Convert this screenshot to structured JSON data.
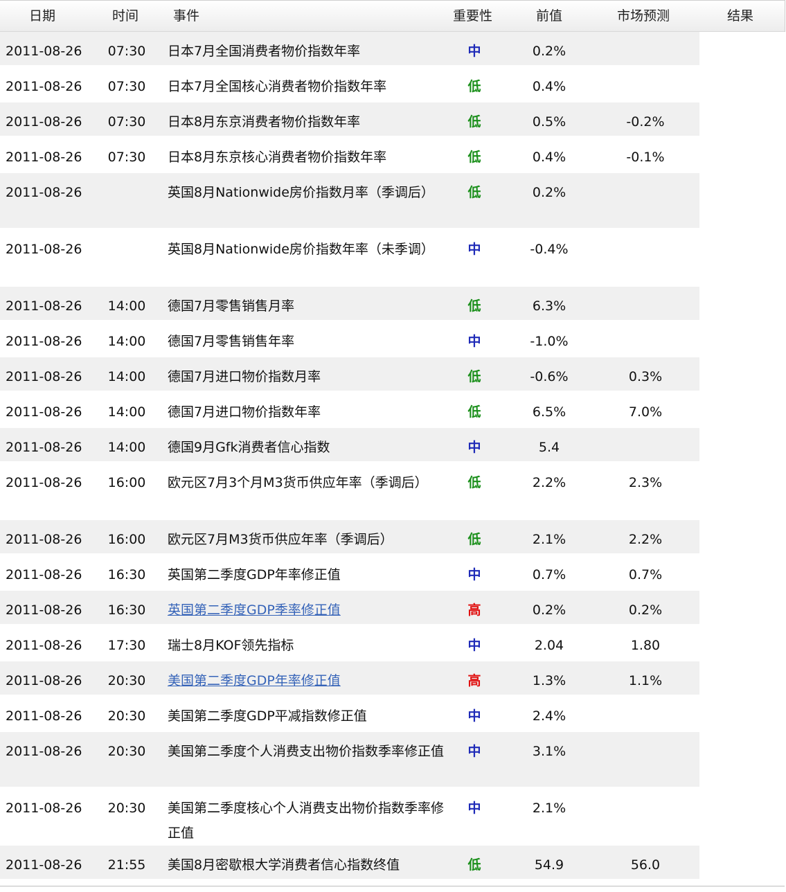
{
  "headers": {
    "date": "日期",
    "time": "时间",
    "event": "事件",
    "importance": "重要性",
    "previous": "前值",
    "forecast": "市场预测",
    "result": "结果"
  },
  "levels": {
    "low": "低",
    "mid": "中",
    "high": "高"
  },
  "colors": {
    "low": "#1a8f1a",
    "mid": "#1f2bb8",
    "high": "#e01010",
    "link": "#3563b8",
    "row_alt": "#f0f0f0"
  },
  "rows": [
    {
      "date": "2011-08-26",
      "time": "07:30",
      "event": "日本7月全国消费者物价指数年率",
      "importance": "中",
      "level": "mid",
      "previous": "0.2%",
      "forecast": "",
      "result": "",
      "link": false
    },
    {
      "date": "2011-08-26",
      "time": "07:30",
      "event": "日本7月全国核心消费者物价指数年率",
      "importance": "低",
      "level": "low",
      "previous": "0.4%",
      "forecast": "",
      "result": "",
      "link": false
    },
    {
      "date": "2011-08-26",
      "time": "07:30",
      "event": "日本8月东京消费者物价指数年率",
      "importance": "低",
      "level": "low",
      "previous": "0.5%",
      "forecast": "-0.2%",
      "result": "",
      "link": false
    },
    {
      "date": "2011-08-26",
      "time": "07:30",
      "event": "日本8月东京核心消费者物价指数年率",
      "importance": "低",
      "level": "low",
      "previous": "0.4%",
      "forecast": "-0.1%",
      "result": "",
      "link": false
    },
    {
      "date": "2011-08-26",
      "time": "",
      "event": "英国8月Nationwide房价指数月率（季调后）",
      "importance": "低",
      "level": "low",
      "previous": "0.2%",
      "forecast": "",
      "result": "",
      "link": false,
      "tall": true
    },
    {
      "date": "2011-08-26",
      "time": "",
      "event": "英国8月Nationwide房价指数年率（未季调）",
      "importance": "中",
      "level": "mid",
      "previous": "-0.4%",
      "forecast": "",
      "result": "",
      "link": false,
      "tall": true
    },
    {
      "date": "2011-08-26",
      "time": "14:00",
      "event": "德国7月零售销售月率",
      "importance": "低",
      "level": "low",
      "previous": "6.3%",
      "forecast": "",
      "result": "",
      "link": false
    },
    {
      "date": "2011-08-26",
      "time": "14:00",
      "event": "德国7月零售销售年率",
      "importance": "中",
      "level": "mid",
      "previous": "-1.0%",
      "forecast": "",
      "result": "",
      "link": false
    },
    {
      "date": "2011-08-26",
      "time": "14:00",
      "event": "德国7月进口物价指数月率",
      "importance": "低",
      "level": "low",
      "previous": "-0.6%",
      "forecast": "0.3%",
      "result": "",
      "link": false
    },
    {
      "date": "2011-08-26",
      "time": "14:00",
      "event": "德国7月进口物价指数年率",
      "importance": "低",
      "level": "low",
      "previous": "6.5%",
      "forecast": "7.0%",
      "result": "",
      "link": false
    },
    {
      "date": "2011-08-26",
      "time": "14:00",
      "event": "德国9月Gfk消费者信心指数",
      "importance": "中",
      "level": "mid",
      "previous": "5.4",
      "forecast": "",
      "result": "",
      "link": false
    },
    {
      "date": "2011-08-26",
      "time": "16:00",
      "event": "欧元区7月3个月M3货币供应年率（季调后）",
      "importance": "低",
      "level": "low",
      "previous": "2.2%",
      "forecast": "2.3%",
      "result": "",
      "link": false,
      "tall": true
    },
    {
      "date": "2011-08-26",
      "time": "16:00",
      "event": "欧元区7月M3货币供应年率（季调后）",
      "importance": "低",
      "level": "low",
      "previous": "2.1%",
      "forecast": "2.2%",
      "result": "",
      "link": false
    },
    {
      "date": "2011-08-26",
      "time": "16:30",
      "event": "英国第二季度GDP年率修正值",
      "importance": "中",
      "level": "mid",
      "previous": "0.7%",
      "forecast": "0.7%",
      "result": "",
      "link": false
    },
    {
      "date": "2011-08-26",
      "time": "16:30",
      "event": "英国第二季度GDP季率修正值",
      "importance": "高",
      "level": "high",
      "previous": "0.2%",
      "forecast": "0.2%",
      "result": "",
      "link": true
    },
    {
      "date": "2011-08-26",
      "time": "17:30",
      "event": "瑞士8月KOF领先指标",
      "importance": "中",
      "level": "mid",
      "previous": "2.04",
      "forecast": "1.80",
      "result": "",
      "link": false
    },
    {
      "date": "2011-08-26",
      "time": "20:30",
      "event": "美国第二季度GDP年率修正值",
      "importance": "高",
      "level": "high",
      "previous": "1.3%",
      "forecast": "1.1%",
      "result": "",
      "link": true
    },
    {
      "date": "2011-08-26",
      "time": "20:30",
      "event": "美国第二季度GDP平减指数修正值",
      "importance": "中",
      "level": "mid",
      "previous": "2.4%",
      "forecast": "",
      "result": "",
      "link": false
    },
    {
      "date": "2011-08-26",
      "time": "20:30",
      "event": "美国第二季度个人消费支出物价指数季率修正值",
      "importance": "中",
      "level": "mid",
      "previous": "3.1%",
      "forecast": "",
      "result": "",
      "link": false,
      "tall": true
    },
    {
      "date": "2011-08-26",
      "time": "20:30",
      "event": "美国第二季度核心个人消费支出物价指数季率修正值",
      "importance": "中",
      "level": "mid",
      "previous": "2.1%",
      "forecast": "",
      "result": "",
      "link": false,
      "tall": true
    },
    {
      "date": "2011-08-26",
      "time": "21:55",
      "event": "美国8月密歇根大学消费者信心指数终值",
      "importance": "低",
      "level": "low",
      "previous": "54.9",
      "forecast": "56.0",
      "result": "",
      "link": false
    }
  ]
}
